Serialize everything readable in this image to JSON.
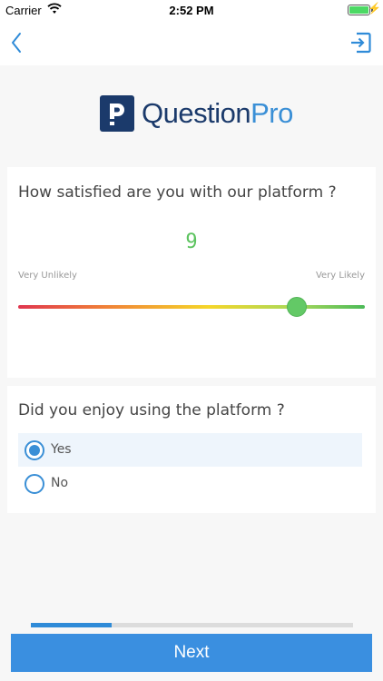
{
  "status_bar": {
    "carrier": "Carrier",
    "time": "2:52 PM"
  },
  "nav": {
    "back_icon": "chevron-left-icon",
    "exit_icon": "exit-icon",
    "accent": "#2f8bd8"
  },
  "logo": {
    "brand_question": "Question",
    "brand_pro": "Pro"
  },
  "question1": {
    "title": "How satisfied are you with our platform ?",
    "value": "9",
    "min_label": "Very Unlikely",
    "max_label": "Very Likely",
    "slider_value": 9,
    "slider_max": 10
  },
  "question2": {
    "title": "Did you enjoy using the platform ?",
    "options": [
      {
        "label": "Yes",
        "selected": true
      },
      {
        "label": "No",
        "selected": false
      }
    ]
  },
  "progress": {
    "fraction": 0.25
  },
  "next_label": "Next",
  "colors": {
    "primary": "#3a8fe0",
    "score": "#5cc35f",
    "brand_dark": "#1b3a6b"
  }
}
